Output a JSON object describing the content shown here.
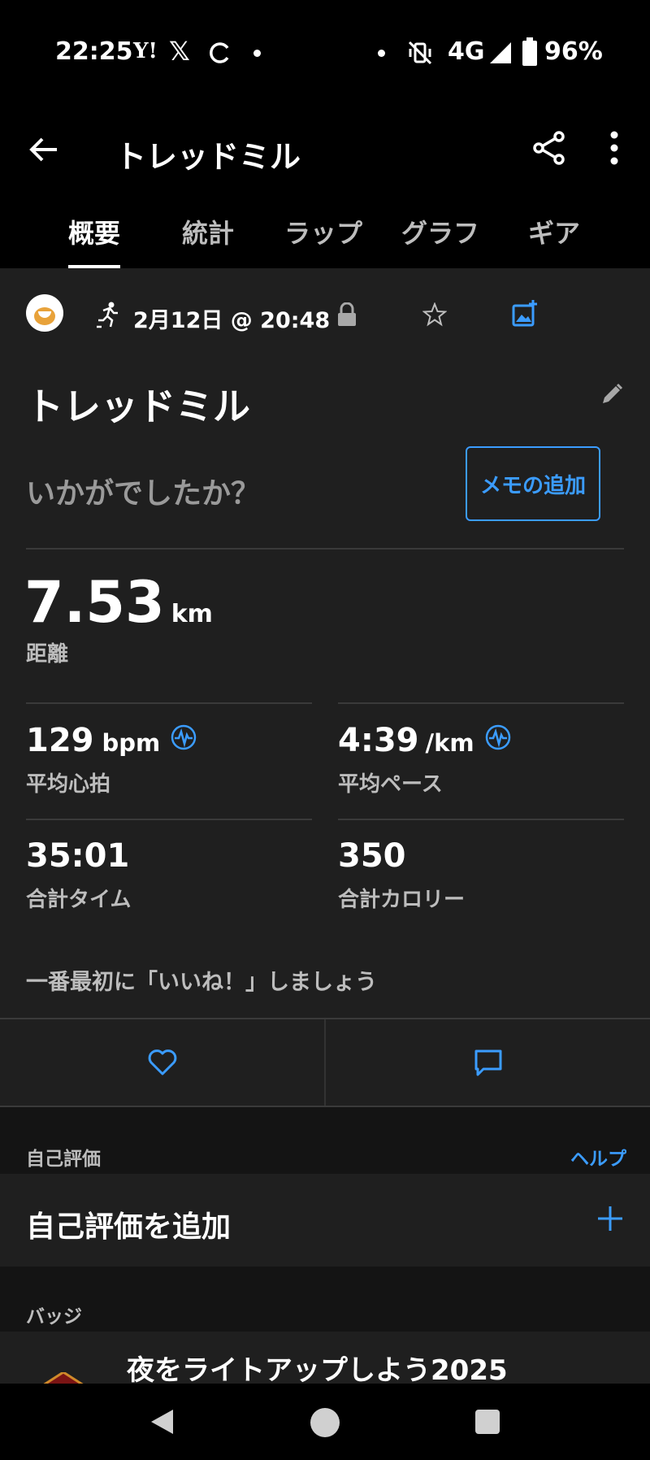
{
  "status_bar": {
    "time": "22:25",
    "yahoo": "Y!",
    "x": "𝕏",
    "network": "4G",
    "battery": "96%"
  },
  "app_bar": {
    "title": "トレッドミル",
    "tabs": [
      "概要",
      "統計",
      "ラップ",
      "グラフ",
      "ギア"
    ]
  },
  "activity": {
    "date": "2月12日 @ 20:48",
    "title": "トレッドミル",
    "question": "いかがでしたか？",
    "memo_button": "メモの追加",
    "distance_value": "7.53",
    "distance_unit": "km",
    "distance_label": "距離",
    "stats": [
      {
        "value": "129",
        "unit": "bpm",
        "label": "平均心拍"
      },
      {
        "value": "4:39",
        "unit": "/km",
        "label": "平均ペース"
      },
      {
        "value": "35:01",
        "unit": "",
        "label": "合計タイム"
      },
      {
        "value": "350",
        "unit": "",
        "label": "合計カロリー"
      }
    ],
    "like_prompt": "一番最初に「いいね！」しましょう"
  },
  "self_eval": {
    "section_label": "自己評価",
    "help": "ヘルプ",
    "add_label": "自己評価を追加"
  },
  "badges": {
    "section_label": "バッジ",
    "item_title": "夜をライトアップしよう2025"
  },
  "colors": {
    "accent": "#3b9cff",
    "background": "#1f1f1f",
    "section": "#141414"
  }
}
